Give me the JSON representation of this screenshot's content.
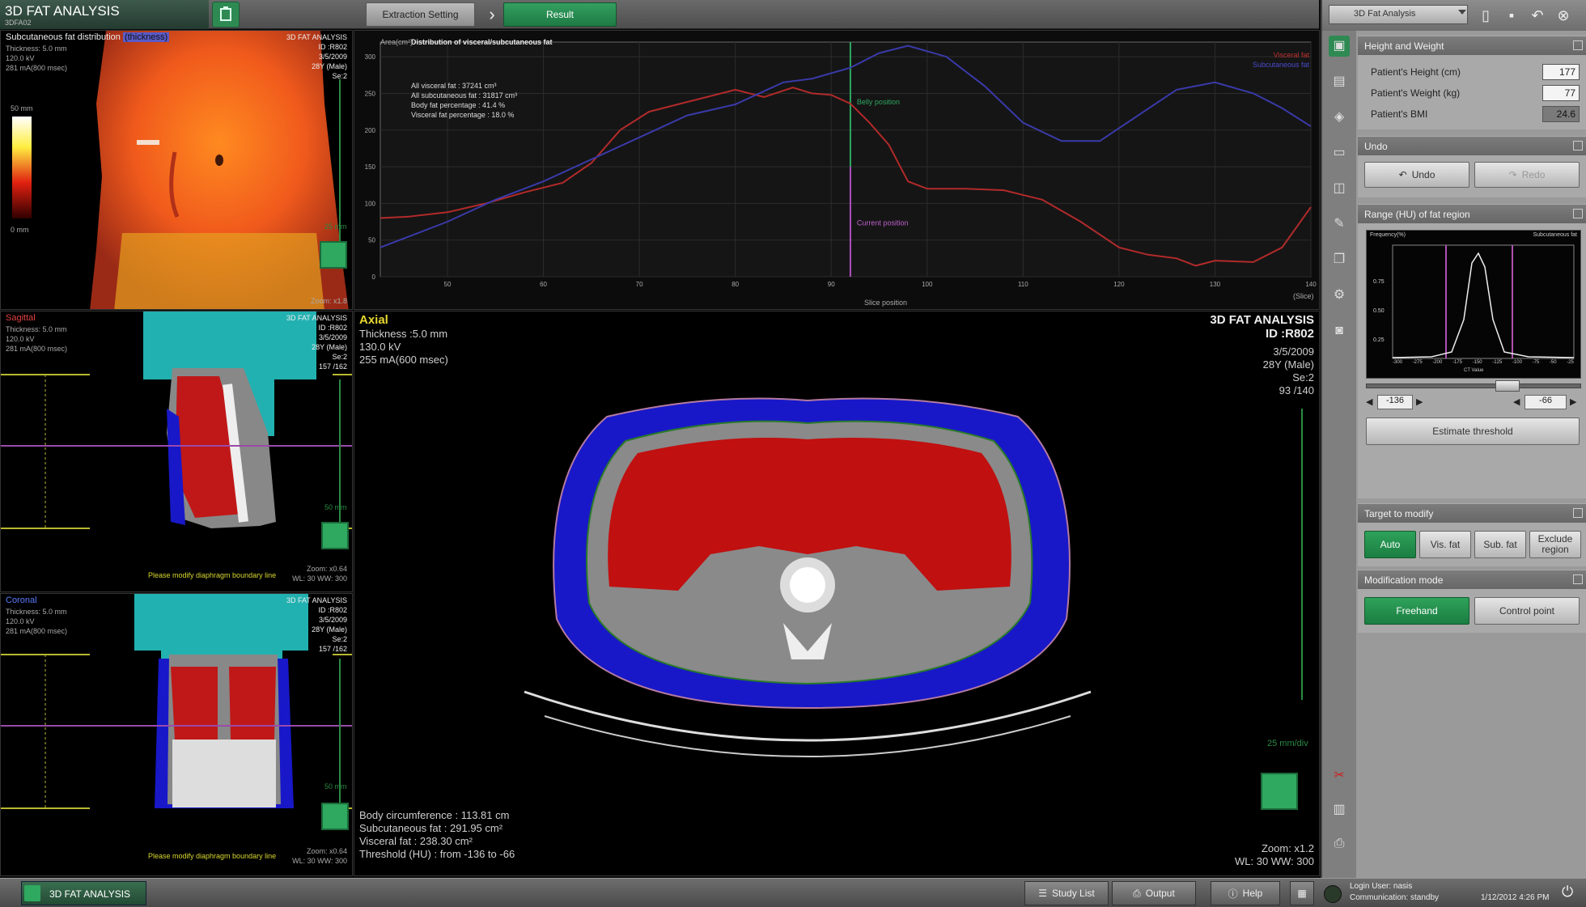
{
  "app": {
    "title": "3D FAT ANALYSIS",
    "sub": "3DFA02"
  },
  "steps": {
    "extraction": "Extraction Setting",
    "result": "Result"
  },
  "right_panel": {
    "protocol": "3D Fat Analysis",
    "height_weight": {
      "header": "Height and Weight",
      "height_label": "Patient's Height (cm)",
      "height_value": "177",
      "weight_label": "Patient's Weight (kg)",
      "weight_value": "77",
      "bmi_label": "Patient's BMI",
      "bmi_value": "24.6"
    },
    "undo": {
      "header": "Undo",
      "undo_label": "Undo",
      "redo_label": "Redo"
    },
    "range": {
      "header": "Range (HU) of fat region",
      "hist_ylabel": "Frequency(%)",
      "hist_series": "Subcutaneous fat",
      "hist_yticks": [
        "0.75",
        "0.50",
        "0.25"
      ],
      "hist_xticks": [
        "-300",
        "-275",
        "-200",
        "-175",
        "-150",
        "-125",
        "-100",
        "-75",
        "-50",
        "-25"
      ],
      "hist_xlabel": "CT Value",
      "low": "-136",
      "high": "-66",
      "estimate_label": "Estimate threshold"
    },
    "target": {
      "header": "Target to modify",
      "auto": "Auto",
      "vis": "Vis. fat",
      "sub": "Sub. fat",
      "exclude": "Exclude region"
    },
    "mode": {
      "header": "Modification mode",
      "freehand": "Freehand",
      "control": "Control point"
    }
  },
  "vr_view": {
    "title": "Subcutaneous fat distribution",
    "title_hl": "(thickness)",
    "info": [
      "Thickness: 5.0 mm",
      "120.0 kV",
      "281 mA(800 msec)"
    ],
    "right": [
      "3D FAT ANALYSIS",
      "ID :R802",
      "3/5/2009",
      "28Y (Male)",
      "Se:2"
    ],
    "scale_top": "50 mm",
    "scale_bottom": "0 mm",
    "ruler_label": "25 mm",
    "zoom": "Zoom: x1.8"
  },
  "sagittal_view": {
    "title": "Sagittal",
    "info": [
      "Thickness: 5.0 mm",
      "120.0 kV",
      "281 mA(800 msec)"
    ],
    "right": [
      "3D FAT ANALYSIS",
      "ID :R802",
      "3/5/2009",
      "28Y (Male)",
      "Se:2",
      "157 /162"
    ],
    "ruler_label": "50 mm",
    "note": "Please modify diaphragm boundary line",
    "zoom": "Zoom: x0.64",
    "wl": "WL: 30  WW: 300"
  },
  "coronal_view": {
    "title": "Coronal",
    "info": [
      "Thickness: 5.0 mm",
      "120.0 kV",
      "281 mA(800 msec)"
    ],
    "right": [
      "3D FAT ANALYSIS",
      "ID :R802",
      "3/5/2009",
      "28Y (Male)",
      "Se:2",
      "157 /162"
    ],
    "ruler_label": "50 mm",
    "note": "Please modify diaphragm boundary line",
    "zoom": "Zoom: x0.64",
    "wl": "WL: 30  WW: 300"
  },
  "axial_view": {
    "title": "Axial",
    "info": [
      "Thickness :5.0 mm",
      "130.0 kV",
      "255 mA(600 msec)"
    ],
    "right_title": "3D FAT ANALYSIS",
    "right_id": "ID :R802",
    "right": [
      "3/5/2009",
      "28Y (Male)",
      "Se:2",
      "93 /140"
    ],
    "ruler_label": "25 mm/div",
    "stats": [
      "Body circumference : 113.81 cm",
      "Subcutaneous fat : 291.95 cm²",
      "Visceral fat : 238.30 cm²",
      "Threshold (HU) : from -136 to -66"
    ],
    "zoom": "Zoom: x1.2",
    "wl": "WL: 30  WW: 300"
  },
  "chart_data": {
    "type": "line",
    "title": "Distribution of visceral/subcutaneous fat",
    "xlabel": "Slice position",
    "ylabel": "Area(cm²)",
    "xunit": "(Slice)",
    "xlim": [
      43,
      140
    ],
    "ylim": [
      0,
      320
    ],
    "xticks": [
      50,
      60,
      70,
      80,
      90,
      100,
      110,
      120,
      130,
      140
    ],
    "yticks": [
      0,
      50,
      100,
      150,
      200,
      250,
      300
    ],
    "summary": [
      "All visceral fat : 37241 cm³",
      "All subcutaneous fat : 31817 cm³",
      "Body fat percentage : 41.4 %",
      "Visceral fat percentage : 18.0 %"
    ],
    "belly_label": "Belly position",
    "belly_x": 92,
    "current_label": "Current position",
    "current_x": 93,
    "series": [
      {
        "name": "Visceral fat",
        "color": "#b22a2a",
        "x": [
          43,
          46,
          50,
          54,
          58,
          62,
          65,
          68,
          71,
          74,
          77,
          80,
          83,
          86,
          88,
          90,
          92,
          94,
          96,
          98,
          100,
          104,
          108,
          112,
          116,
          120,
          123,
          126,
          128,
          130,
          134,
          137,
          140
        ],
        "y": [
          80,
          82,
          88,
          100,
          115,
          128,
          155,
          200,
          225,
          235,
          245,
          255,
          245,
          258,
          250,
          248,
          236,
          210,
          180,
          130,
          120,
          120,
          118,
          105,
          75,
          40,
          30,
          25,
          15,
          22,
          20,
          40,
          95
        ]
      },
      {
        "name": "Subcutaneous fat",
        "color": "#3a3aaa",
        "x": [
          43,
          46,
          50,
          55,
          60,
          65,
          70,
          75,
          80,
          85,
          88,
          92,
          95,
          98,
          102,
          106,
          110,
          114,
          118,
          122,
          126,
          130,
          134,
          137,
          140
        ],
        "y": [
          40,
          55,
          75,
          105,
          130,
          160,
          190,
          220,
          235,
          265,
          270,
          285,
          305,
          315,
          300,
          260,
          210,
          185,
          185,
          220,
          255,
          265,
          250,
          230,
          205
        ]
      }
    ]
  },
  "bottom": {
    "task": "3D FAT ANALYSIS",
    "studylist": "Study List",
    "output": "Output",
    "help": "Help",
    "status": [
      "Login User: nasis",
      "Communication: standby"
    ],
    "datetime": "1/12/2012 4:26 PM"
  }
}
